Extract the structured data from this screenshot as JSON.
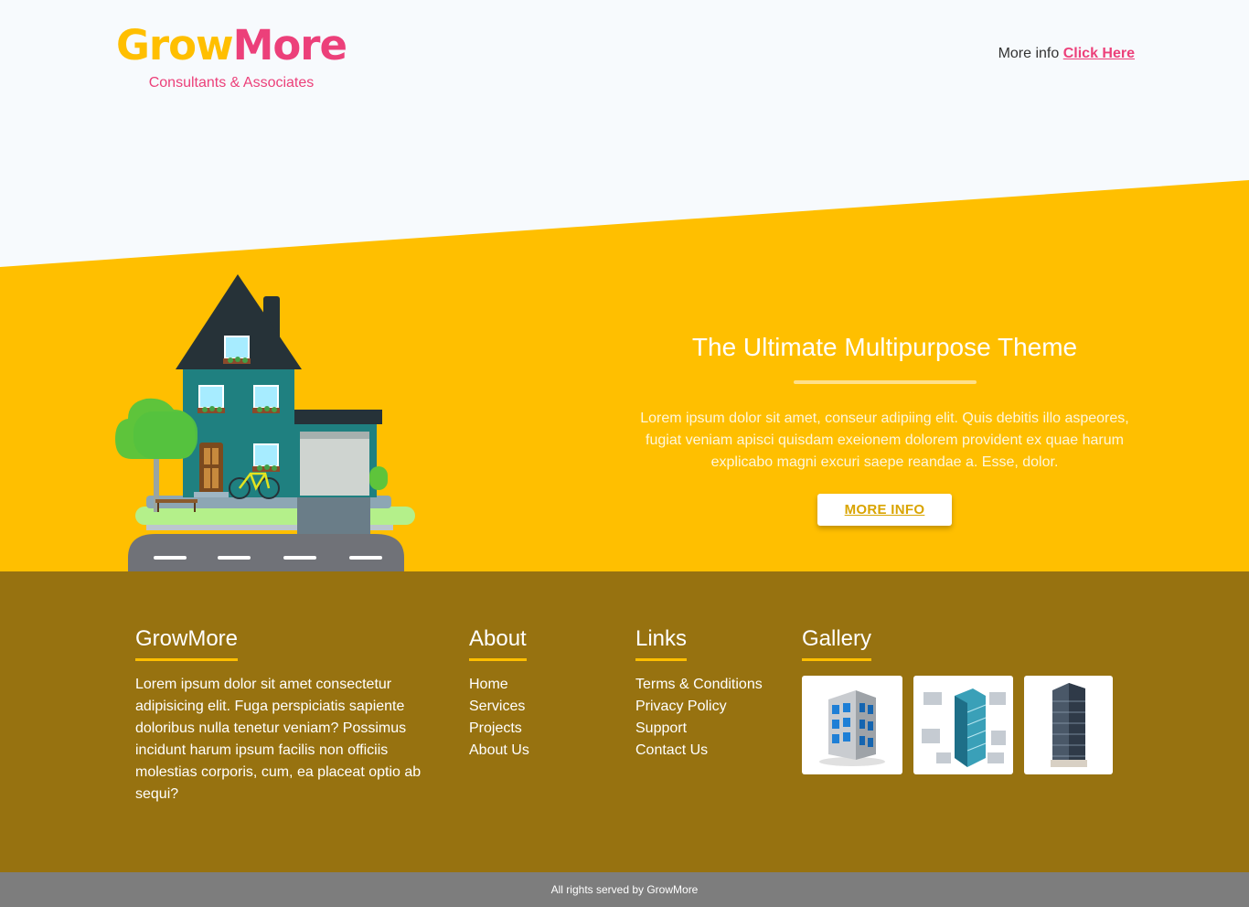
{
  "header": {
    "logo_part1": "Grow",
    "logo_part2": "More",
    "tagline": "Consultants & Associates",
    "info_text": "More info",
    "info_link": "Click Here"
  },
  "hero": {
    "title": "The Ultimate Multipurpose Theme",
    "description": "Lorem ipsum dolor sit amet, conseur adipiing elit. Quis debitis illo aspeores, fugiat veniam apisci quisdam exeionem dolorem provident ex quae harum explicabo magni excuri saepe reandae a. Esse, dolor.",
    "button_label": "MORE INFO"
  },
  "footer": {
    "brand": {
      "heading": "GrowMore",
      "text": "Lorem ipsum dolor sit amet consectetur adipisicing elit. Fuga perspiciatis sapiente doloribus nulla tenetur veniam? Possimus incidunt harum ipsum facilis non officiis molestias corporis, cum, ea placeat optio ab sequi?"
    },
    "about": {
      "heading": "About",
      "items": [
        "Home",
        "Services",
        "Projects",
        "About Us"
      ]
    },
    "links": {
      "heading": "Links",
      "items": [
        "Terms & Conditions",
        "Privacy Policy",
        "Support",
        "Contact Us"
      ]
    },
    "gallery": {
      "heading": "Gallery",
      "images": [
        "office-building-icon",
        "isometric-tower-icon",
        "skyscraper-photo"
      ]
    },
    "copyright": "All rights served by GrowMore"
  },
  "colors": {
    "accent_yellow": "#ffbf00",
    "accent_pink": "#ec407a",
    "footer_bg": "#977210",
    "copyright_bg": "#7d7d7d"
  }
}
